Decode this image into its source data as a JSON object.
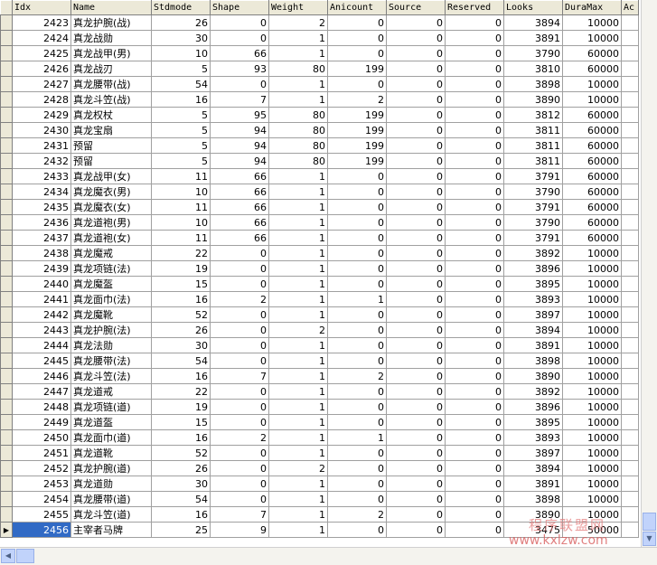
{
  "columns": [
    "Idx",
    "Name",
    "Stdmode",
    "Shape",
    "Weight",
    "Anicount",
    "Source",
    "Reserved",
    "Looks",
    "DuraMax",
    "Ac"
  ],
  "rows": [
    [
      "2423",
      "真龙护腕(战)",
      "26",
      "0",
      "2",
      "0",
      "0",
      "0",
      "3894",
      "10000"
    ],
    [
      "2424",
      "真龙战勋",
      "30",
      "0",
      "1",
      "0",
      "0",
      "0",
      "3891",
      "10000"
    ],
    [
      "2425",
      "真龙战甲(男)",
      "10",
      "66",
      "1",
      "0",
      "0",
      "0",
      "3790",
      "60000"
    ],
    [
      "2426",
      "真龙战刃",
      "5",
      "93",
      "80",
      "199",
      "0",
      "0",
      "3810",
      "60000"
    ],
    [
      "2427",
      "真龙腰带(战)",
      "54",
      "0",
      "1",
      "0",
      "0",
      "0",
      "3898",
      "10000"
    ],
    [
      "2428",
      "真龙斗笠(战)",
      "16",
      "7",
      "1",
      "2",
      "0",
      "0",
      "3890",
      "10000"
    ],
    [
      "2429",
      "真龙权杖",
      "5",
      "95",
      "80",
      "199",
      "0",
      "0",
      "3812",
      "60000"
    ],
    [
      "2430",
      "真龙宝扇",
      "5",
      "94",
      "80",
      "199",
      "0",
      "0",
      "3811",
      "60000"
    ],
    [
      "2431",
      "预留",
      "5",
      "94",
      "80",
      "199",
      "0",
      "0",
      "3811",
      "60000"
    ],
    [
      "2432",
      "预留",
      "5",
      "94",
      "80",
      "199",
      "0",
      "0",
      "3811",
      "60000"
    ],
    [
      "2433",
      "真龙战甲(女)",
      "11",
      "66",
      "1",
      "0",
      "0",
      "0",
      "3791",
      "60000"
    ],
    [
      "2434",
      "真龙魔衣(男)",
      "10",
      "66",
      "1",
      "0",
      "0",
      "0",
      "3790",
      "60000"
    ],
    [
      "2435",
      "真龙魔衣(女)",
      "11",
      "66",
      "1",
      "0",
      "0",
      "0",
      "3791",
      "60000"
    ],
    [
      "2436",
      "真龙道袍(男)",
      "10",
      "66",
      "1",
      "0",
      "0",
      "0",
      "3790",
      "60000"
    ],
    [
      "2437",
      "真龙道袍(女)",
      "11",
      "66",
      "1",
      "0",
      "0",
      "0",
      "3791",
      "60000"
    ],
    [
      "2438",
      "真龙魔戒",
      "22",
      "0",
      "1",
      "0",
      "0",
      "0",
      "3892",
      "10000"
    ],
    [
      "2439",
      "真龙项链(法)",
      "19",
      "0",
      "1",
      "0",
      "0",
      "0",
      "3896",
      "10000"
    ],
    [
      "2440",
      "真龙魔盔",
      "15",
      "0",
      "1",
      "0",
      "0",
      "0",
      "3895",
      "10000"
    ],
    [
      "2441",
      "真龙面巾(法)",
      "16",
      "2",
      "1",
      "1",
      "0",
      "0",
      "3893",
      "10000"
    ],
    [
      "2442",
      "真龙魔靴",
      "52",
      "0",
      "1",
      "0",
      "0",
      "0",
      "3897",
      "10000"
    ],
    [
      "2443",
      "真龙护腕(法)",
      "26",
      "0",
      "2",
      "0",
      "0",
      "0",
      "3894",
      "10000"
    ],
    [
      "2444",
      "真龙法勋",
      "30",
      "0",
      "1",
      "0",
      "0",
      "0",
      "3891",
      "10000"
    ],
    [
      "2445",
      "真龙腰带(法)",
      "54",
      "0",
      "1",
      "0",
      "0",
      "0",
      "3898",
      "10000"
    ],
    [
      "2446",
      "真龙斗笠(法)",
      "16",
      "7",
      "1",
      "2",
      "0",
      "0",
      "3890",
      "10000"
    ],
    [
      "2447",
      "真龙道戒",
      "22",
      "0",
      "1",
      "0",
      "0",
      "0",
      "3892",
      "10000"
    ],
    [
      "2448",
      "真龙项链(道)",
      "19",
      "0",
      "1",
      "0",
      "0",
      "0",
      "3896",
      "10000"
    ],
    [
      "2449",
      "真龙道盔",
      "15",
      "0",
      "1",
      "0",
      "0",
      "0",
      "3895",
      "10000"
    ],
    [
      "2450",
      "真龙面巾(道)",
      "16",
      "2",
      "1",
      "1",
      "0",
      "0",
      "3893",
      "10000"
    ],
    [
      "2451",
      "真龙道靴",
      "52",
      "0",
      "1",
      "0",
      "0",
      "0",
      "3897",
      "10000"
    ],
    [
      "2452",
      "真龙护腕(道)",
      "26",
      "0",
      "2",
      "0",
      "0",
      "0",
      "3894",
      "10000"
    ],
    [
      "2453",
      "真龙道勋",
      "30",
      "0",
      "1",
      "0",
      "0",
      "0",
      "3891",
      "10000"
    ],
    [
      "2454",
      "真龙腰带(道)",
      "54",
      "0",
      "1",
      "0",
      "0",
      "0",
      "3898",
      "10000"
    ],
    [
      "2455",
      "真龙斗笠(道)",
      "16",
      "7",
      "1",
      "2",
      "0",
      "0",
      "3890",
      "10000"
    ],
    [
      "2456",
      "主宰者马牌",
      "25",
      "9",
      "1",
      "0",
      "0",
      "0",
      "3475",
      "50000"
    ]
  ],
  "active_row": 33,
  "row_indicator": "▶",
  "watermark": {
    "top": "程序联盟网",
    "url": "www.kxlzw.com"
  },
  "icons": {
    "scroll_down": "triangle-down",
    "scroll_left": "triangle-left"
  },
  "colors": {
    "selection": "#316ac5",
    "header_bg": "#ece9d8",
    "scroll_thumb": "#c1d3fb"
  }
}
